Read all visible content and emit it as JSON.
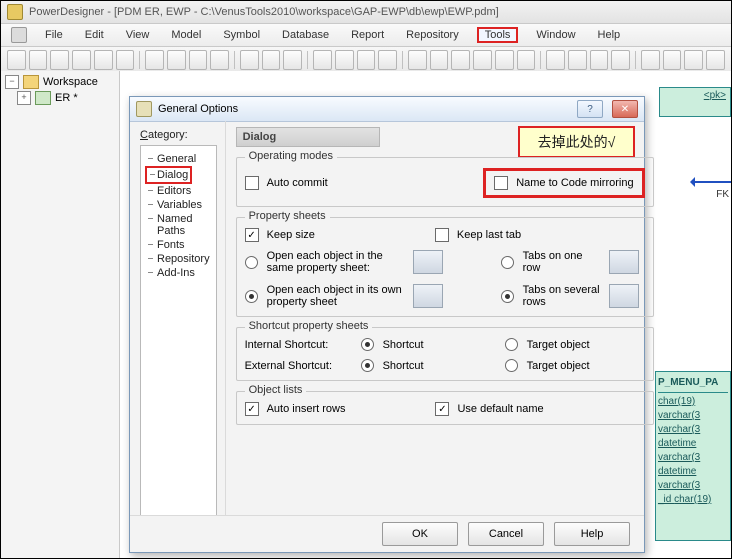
{
  "app": {
    "title": "PowerDesigner - [PDM ER, EWP - C:\\VenusTools2010\\workspace\\GAP-EWP\\db\\ewp\\EWP.pdm]"
  },
  "menu": {
    "items": [
      "File",
      "Edit",
      "View",
      "Model",
      "Symbol",
      "Database",
      "Report",
      "Repository",
      "Tools",
      "Window",
      "Help"
    ],
    "highlight_index": 8
  },
  "sidebar": {
    "workspace": "Workspace",
    "er": "ER *"
  },
  "er_right": {
    "top_label": "<pk>",
    "fk": "FK",
    "menu_title": "P_MENU_PA",
    "menu_rows": [
      "char(19)",
      "varchar(3",
      "varchar(3",
      "datetime",
      "varchar(3",
      "datetime",
      "varchar(3",
      "char(19)"
    ],
    "menu_last_prefix": "_id  "
  },
  "dialog": {
    "title": "General Options",
    "category_label": "Category:",
    "category_underline": "C",
    "tree": [
      "General",
      "Dialog",
      "Editors",
      "Variables",
      "Named Paths",
      "Fonts",
      "Repository",
      "Add-Ins"
    ],
    "tree_highlight_index": 1,
    "header": "Dialog",
    "callout": "去掉此处的√",
    "operating_modes": {
      "legend": "Operating modes",
      "auto_commit": "Auto commit",
      "mirror": "Name to Code mirroring"
    },
    "property_sheets": {
      "legend": "Property sheets",
      "keep_size": "Keep size",
      "keep_last_tab": "Keep last tab",
      "open_same": "Open each object in the same property sheet:",
      "tabs_one": "Tabs on one row",
      "open_own": "Open each object in its own property sheet",
      "tabs_several": "Tabs on several rows"
    },
    "shortcut": {
      "legend": "Shortcut property sheets",
      "internal": "Internal Shortcut:",
      "external": "External Shortcut:",
      "shortcut": "Shortcut",
      "target": "Target object"
    },
    "object_lists": {
      "legend": "Object lists",
      "auto_insert": "Auto insert rows",
      "use_default": "Use default name"
    },
    "buttons": {
      "ok": "OK",
      "cancel": "Cancel",
      "help": "Help"
    }
  }
}
